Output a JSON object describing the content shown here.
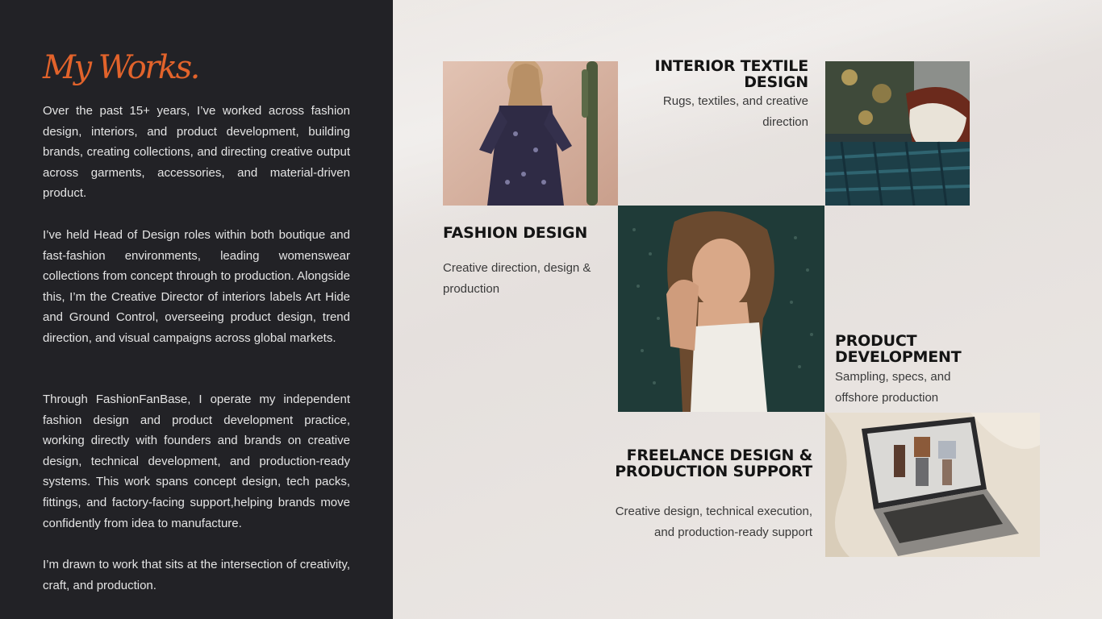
{
  "intro": {
    "heading": "My Works.",
    "paragraphs": [
      "Over the past 15+ years, I’ve worked across fashion design, interiors, and product development, building brands, creating collections, and directing creative output across garments, accessories, and material-driven product.",
      "I’ve held Head of Design roles within both boutique and fast-fashion environments, leading womenswear collections from concept through to production. Alongside this, I’m the Creative Director of interiors labels Art Hide and Ground Control, overseeing product design, trend direction, and visual campaigns across global markets.",
      "Through FashionFanBase, I operate my independent fashion design and product development practice, working directly with founders and brands on creative design, technical development, and production-ready systems. This work spans concept design, tech packs, fittings, and factory-facing support,helping brands move confidently from idea to manufacture.",
      "I’m drawn to work that sits at the intersection of creativity, craft, and production."
    ]
  },
  "services": {
    "interior": {
      "title": "INTERIOR TEXTILE DESIGN",
      "description": "Rugs, textiles, and creative direction"
    },
    "fashion": {
      "title": "FASHION DESIGN",
      "description": "Creative direction,  design & production"
    },
    "product": {
      "title": "PRODUCT DEVELOPMENT",
      "description": "Sampling, specs, and offshore production"
    },
    "freelance": {
      "title": "FREELANCE DESIGN & PRODUCTION SUPPORT",
      "description": "Creative design, technical execution, and production-ready support"
    }
  },
  "colors": {
    "accent": "#e2632b",
    "left_panel": "#222226",
    "right_panel": "#e6e1de"
  }
}
